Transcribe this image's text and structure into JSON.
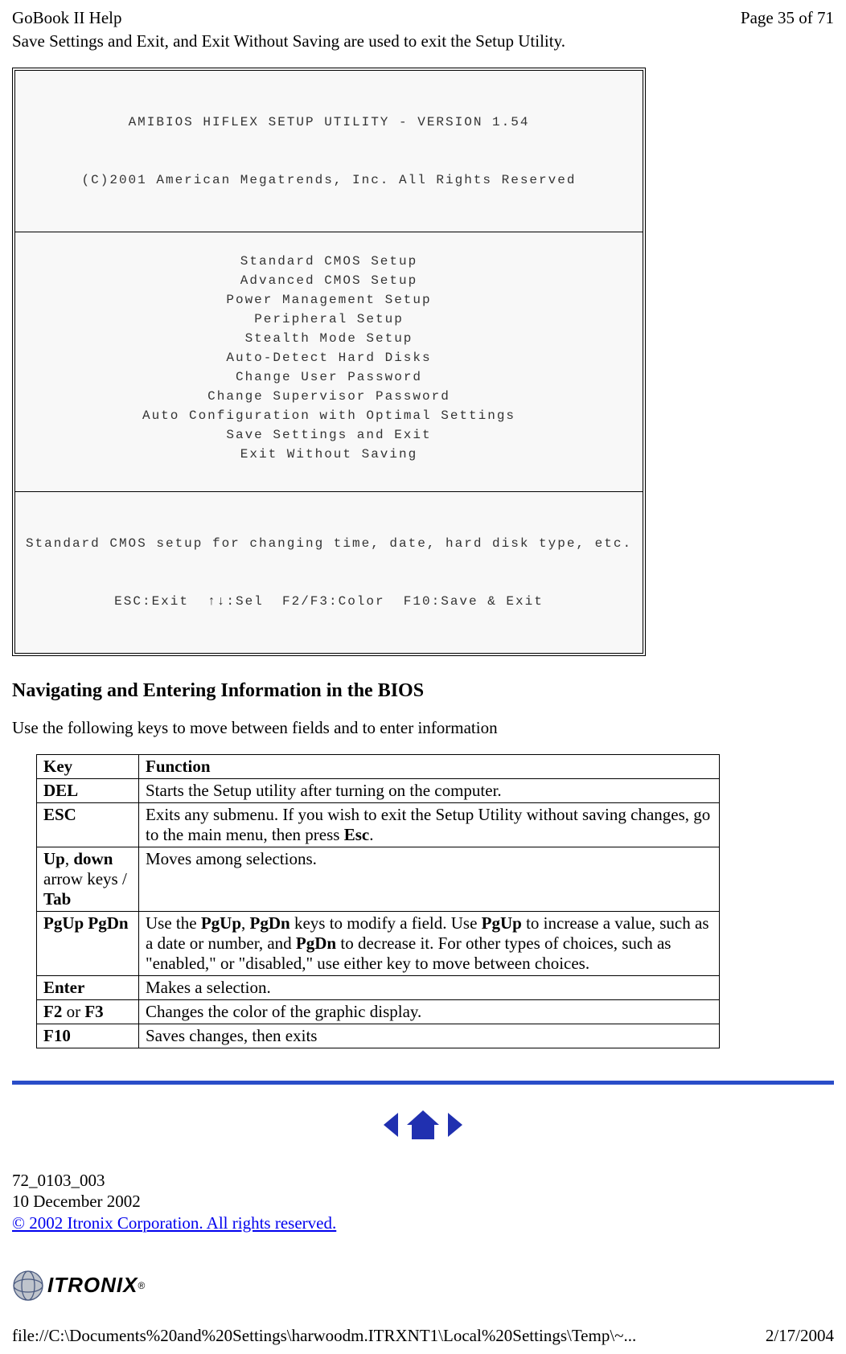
{
  "header_left": "GoBook II Help",
  "header_right": "Page 35 of 71",
  "intro_text": "Save Settings and Exit, and Exit Without Saving are used to exit the Setup Utility.",
  "bios": {
    "title_line1": "AMIBIOS HIFLEX SETUP UTILITY - VERSION 1.54",
    "title_line2": "(C)2001 American Megatrends, Inc. All Rights Reserved",
    "menu_items": [
      "Standard CMOS Setup",
      "Advanced CMOS Setup",
      "Power Management Setup",
      "Peripheral Setup",
      "Stealth Mode Setup",
      "Auto-Detect Hard Disks",
      "Change User Password",
      "Change Supervisor Password",
      "Auto Configuration with Optimal Settings",
      "Save Settings and Exit",
      "Exit Without Saving"
    ],
    "footer_line1": "Standard CMOS setup for changing time, date, hard disk type, etc.",
    "footer_line2": "ESC:Exit  ↑↓:Sel  F2/F3:Color  F10:Save & Exit"
  },
  "section_heading": "Navigating and Entering Information in the BIOS",
  "section_text": "Use the following keys to move between fields and to enter information",
  "table": {
    "head": {
      "col1": "Key",
      "col2": "Function"
    },
    "rows": [
      {
        "key_html": "<b>DEL</b>",
        "func_html": "Starts the Setup utility after turning on the computer."
      },
      {
        "key_html": "<b>ESC</b>",
        "func_html": "Exits any submenu.  If you wish to exit the Setup Utility without saving changes, go to the main menu, then press <b>Esc</b>."
      },
      {
        "key_html": "<b>Up</b>, <b>down</b> arrow keys / <b>Tab</b>",
        "func_html": "Moves among selections."
      },
      {
        "key_html": "<b>PgUp PgDn</b>",
        "func_html": "Use the <b>PgUp</b>, <b>PgDn</b> keys to modify a field.  Use <b>PgUp</b> to increase a value, such as a date or number, and <b>PgDn</b> to decrease it.  For other types of choices, such as &quot;enabled,&quot; or &quot;disabled,&quot; use either key to move between choices."
      },
      {
        "key_html": "<b>Enter</b>",
        "func_html": "Makes a selection."
      },
      {
        "key_html": "<b>F2</b> or <b>F3</b>",
        "func_html": "Changes the color of the graphic display."
      },
      {
        "key_html": "<b>F10</b>",
        "func_html": "Saves changes, then exits"
      }
    ]
  },
  "footer": {
    "docnum": "72_0103_003",
    "date": "10 December 2002",
    "copyright": "© 2002 Itronix Corporation.  All rights reserved.",
    "logo_text": "ITRONIX",
    "path": "file://C:\\Documents%20and%20Settings\\harwoodm.ITRXNT1\\Local%20Settings\\Temp\\~...",
    "print_date": "2/17/2004"
  }
}
